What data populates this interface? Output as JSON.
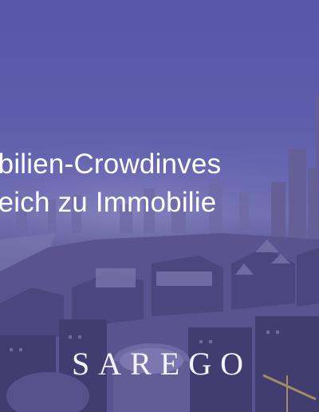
{
  "hero": {
    "headline_line1": "obilien-Crowdinves",
    "headline_line2": "gleich zu Immobilie",
    "brand": "SAREGO",
    "tint_color": "#5a5aa8"
  }
}
